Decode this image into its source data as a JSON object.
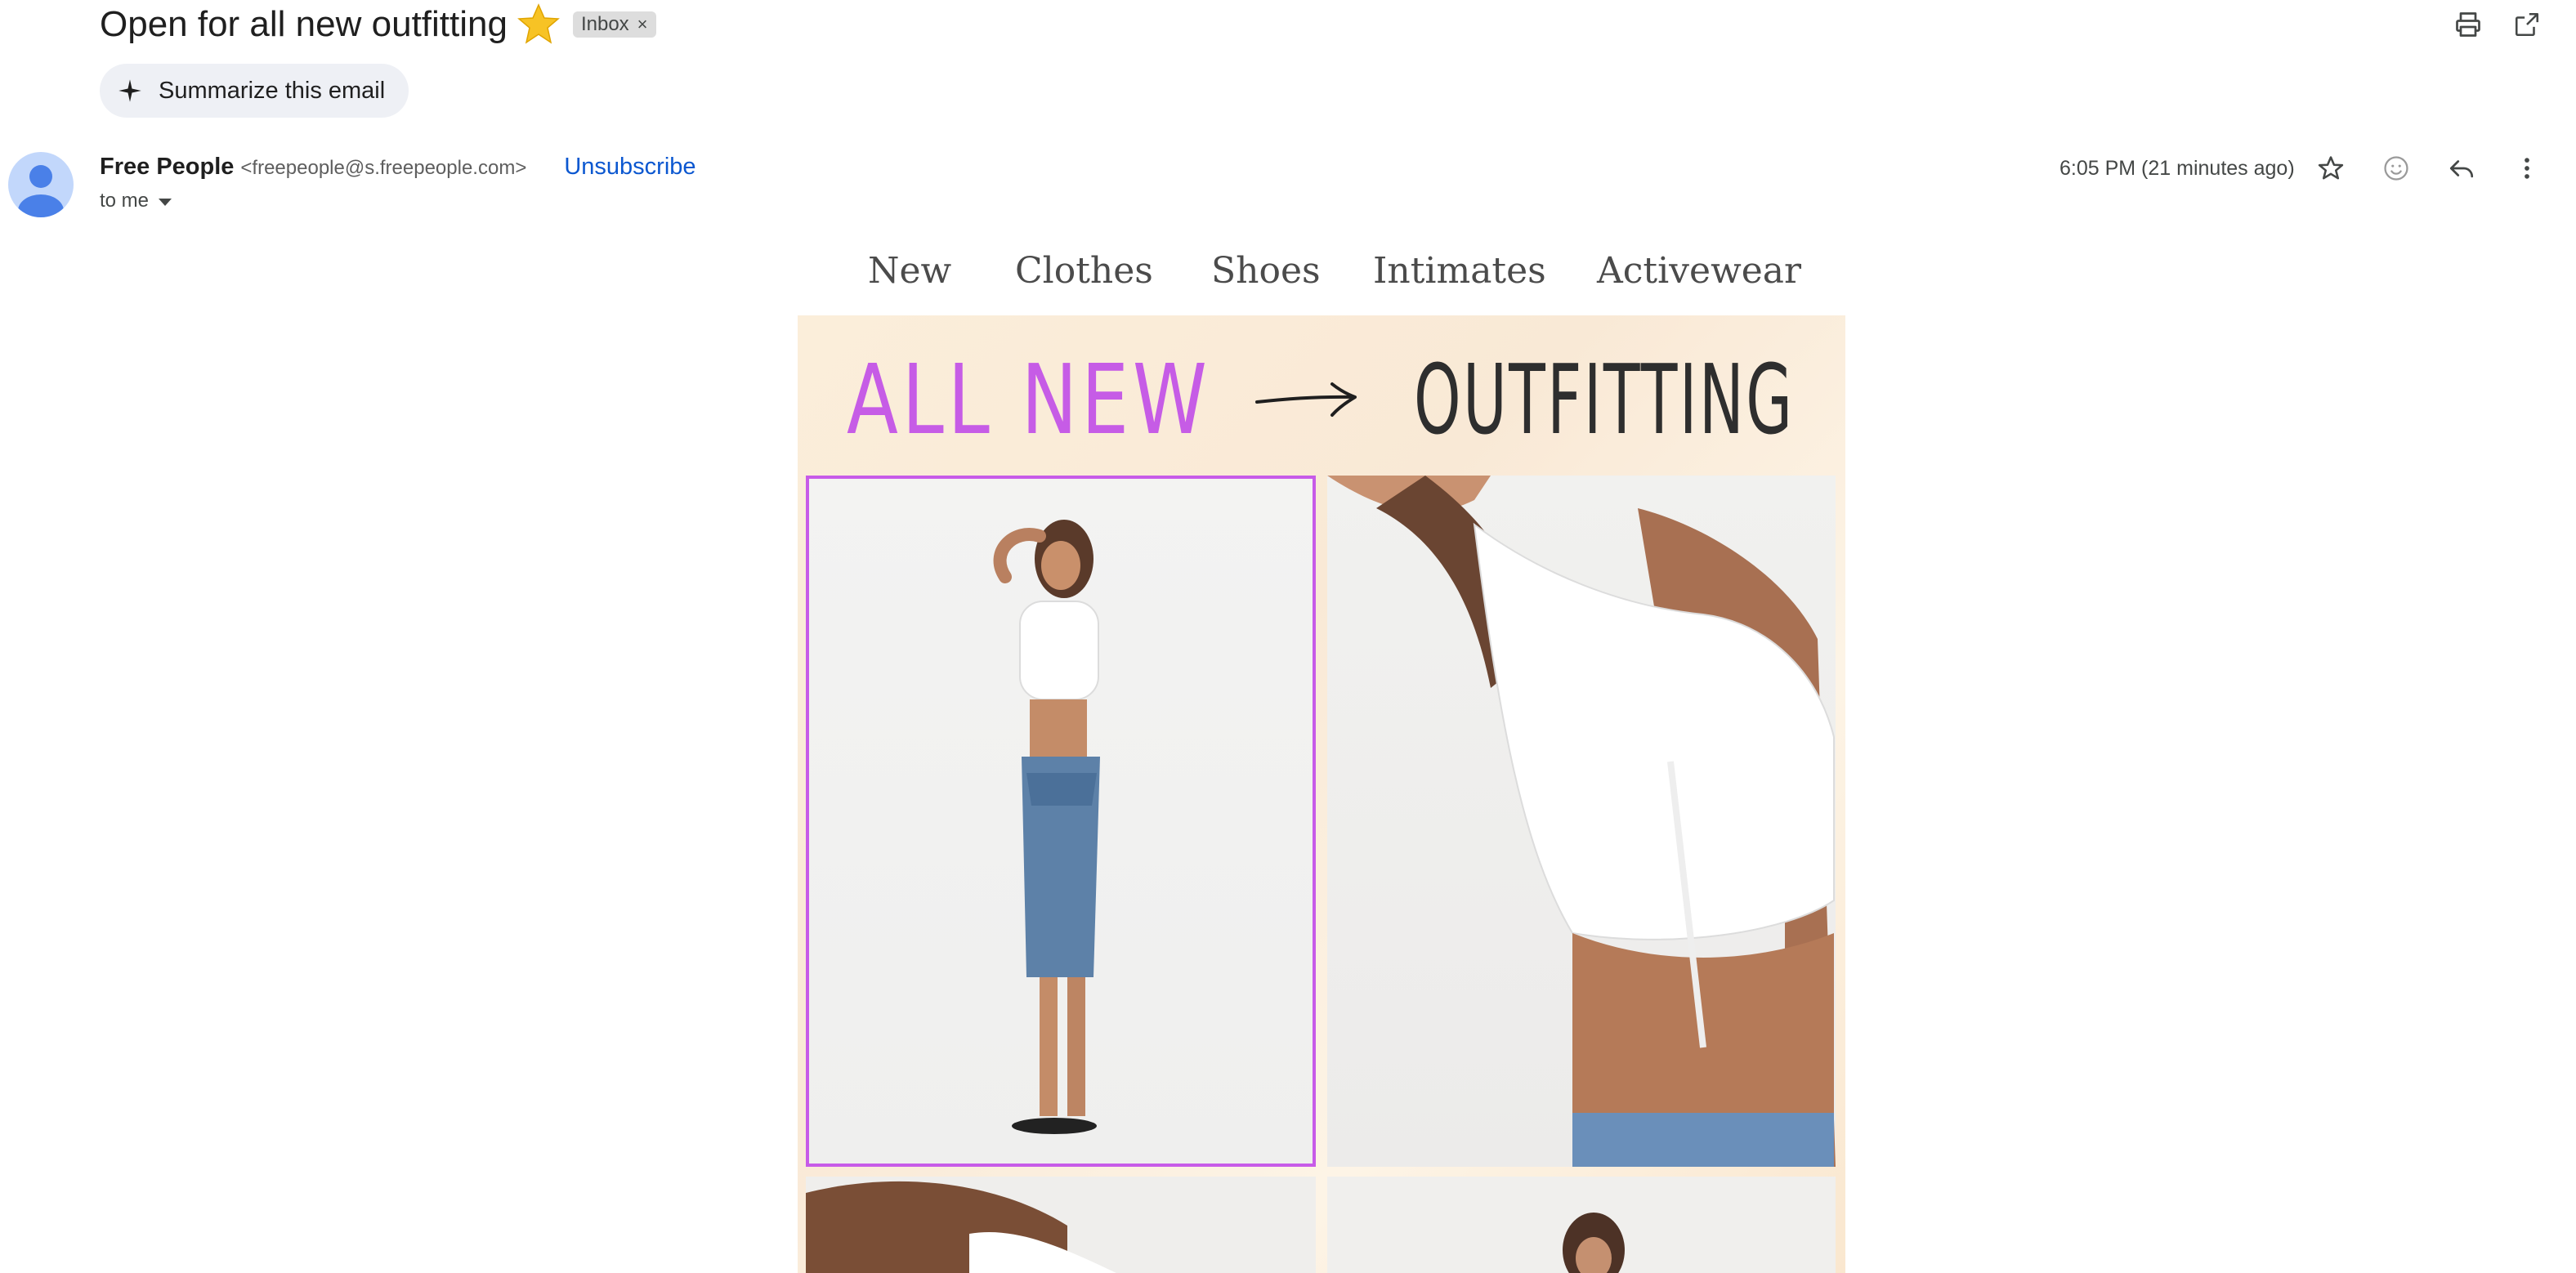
{
  "email": {
    "subject": "Open for all new outfitting",
    "subject_emoji": "star-emoji",
    "label_chip": "Inbox",
    "label_chip_remove": "×",
    "summarize_label": "Summarize this email",
    "sender_name": "Free People",
    "sender_email": "<freepeople@s.freepeople.com>",
    "unsubscribe_label": "Unsubscribe",
    "recipient_label": "to me",
    "timestamp": "6:05 PM (21 minutes ago)"
  },
  "icons": {
    "print": "print-icon",
    "popout": "open-in-new-window-icon",
    "sparkle": "sparkle-icon",
    "star": "star-outline-icon",
    "emoji": "add-reaction-icon",
    "reply": "reply-icon",
    "more": "more-vert-icon",
    "avatar": "default-avatar-icon"
  },
  "newsletter": {
    "nav": [
      "New",
      "Clothes",
      "Shoes",
      "Intimates",
      "Activewear"
    ],
    "banner_left": "ALL NEW",
    "banner_right": "OUTFITTING"
  },
  "colors": {
    "accent_link": "#0b57d0",
    "banner_purple": "#c65ce6",
    "banner_dark": "#2e2e2e",
    "highlight_border": "#c75be8"
  }
}
